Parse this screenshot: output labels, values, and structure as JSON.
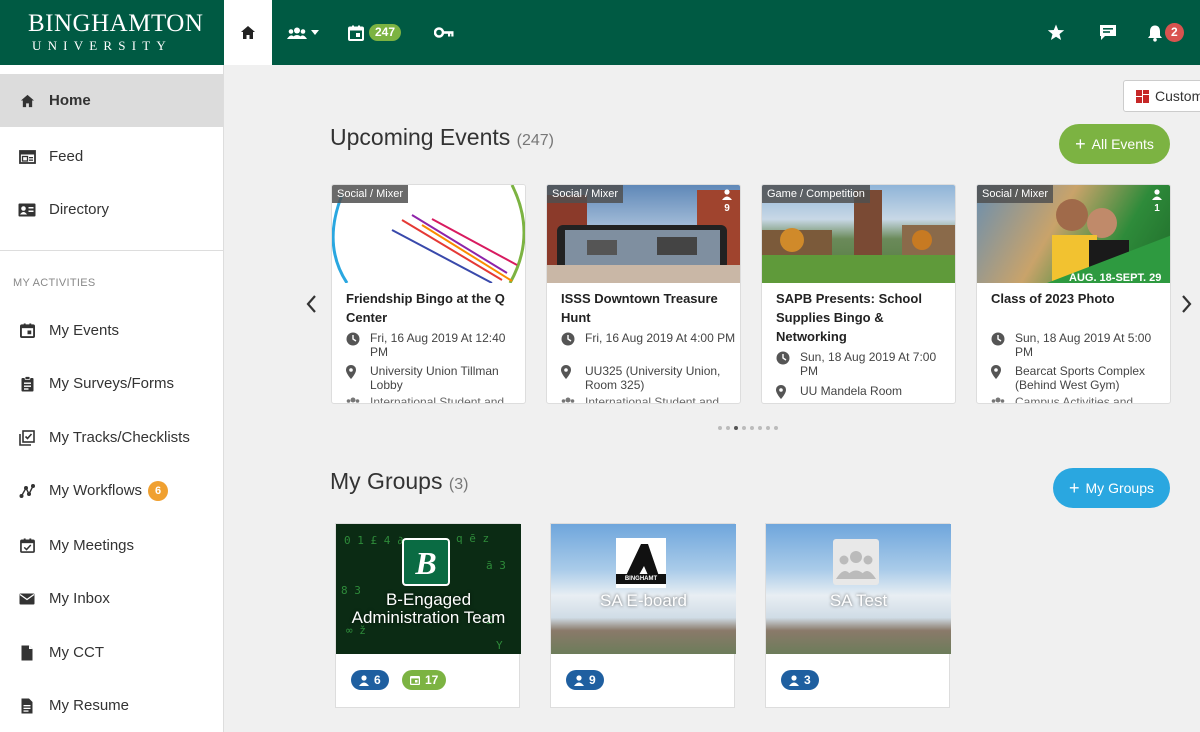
{
  "header": {
    "logo_line1": "BINGHAMTON",
    "logo_line2": "UNIVERSITY",
    "events_count": "247",
    "notifications_count": "2"
  },
  "sidebar": {
    "items": [
      {
        "label": "Home",
        "icon": "home-icon"
      },
      {
        "label": "Feed",
        "icon": "feed-icon"
      },
      {
        "label": "Directory",
        "icon": "directory-icon"
      }
    ],
    "heading": "MY ACTIVITIES",
    "activities": [
      {
        "label": "My Events",
        "icon": "calendar-icon"
      },
      {
        "label": "My Surveys/Forms",
        "icon": "clipboard-icon"
      },
      {
        "label": "My Tracks/Checklists",
        "icon": "checklist-icon"
      },
      {
        "label": "My Workflows",
        "icon": "workflow-icon",
        "badge": "6"
      },
      {
        "label": "My Meetings",
        "icon": "meeting-icon"
      },
      {
        "label": "My Inbox",
        "icon": "envelope-icon"
      },
      {
        "label": "My CCT",
        "icon": "document-icon"
      },
      {
        "label": "My Resume",
        "icon": "resume-icon"
      }
    ]
  },
  "customize_label": "Custom",
  "upcoming": {
    "title": "Upcoming Events",
    "count": "(247)",
    "button": "All Events",
    "events": [
      {
        "category": "Social / Mixer",
        "title": "Friendship Bingo at the Q Center",
        "date": "Fri, 16 Aug 2019 At 12:40 PM",
        "location": "University Union Tillman Lobby",
        "org": "International Student and"
      },
      {
        "category": "Social / Mixer",
        "people": "9",
        "title": "ISSS Downtown Treasure Hunt",
        "date": "Fri, 16 Aug 2019 At 4:00 PM",
        "location": "UU325 (University Union, Room 325)",
        "org": "International Student and"
      },
      {
        "category": "Game / Competition",
        "title": "SAPB Presents: School Supplies Bingo & Networking",
        "date": "Sun, 18 Aug 2019 At 7:00 PM",
        "location": "UU Mandela Room"
      },
      {
        "category": "Social / Mixer",
        "people": "1",
        "banner": "AUG. 18-SEPT. 29",
        "title": "Class of 2023 Photo",
        "date": "Sun, 18 Aug 2019 At 5:00 PM",
        "location": "Bearcat Sports Complex (Behind West Gym)",
        "org": "Campus Activities and"
      }
    ]
  },
  "groups": {
    "title": "My Groups",
    "count": "(3)",
    "button": "My Groups",
    "items": [
      {
        "name": "B-Engaged Administration Team",
        "members": "6",
        "events": "17"
      },
      {
        "name": "SA E-board",
        "members": "9",
        "logo_text": "BINGHAMT"
      },
      {
        "name": "SA Test",
        "members": "3"
      }
    ]
  },
  "colors": {
    "brand_green": "#005a43",
    "accent_green": "#7cb342",
    "accent_blue": "#2aa7e0",
    "badge_red": "#d9534f",
    "badge_orange": "#f0a030"
  }
}
